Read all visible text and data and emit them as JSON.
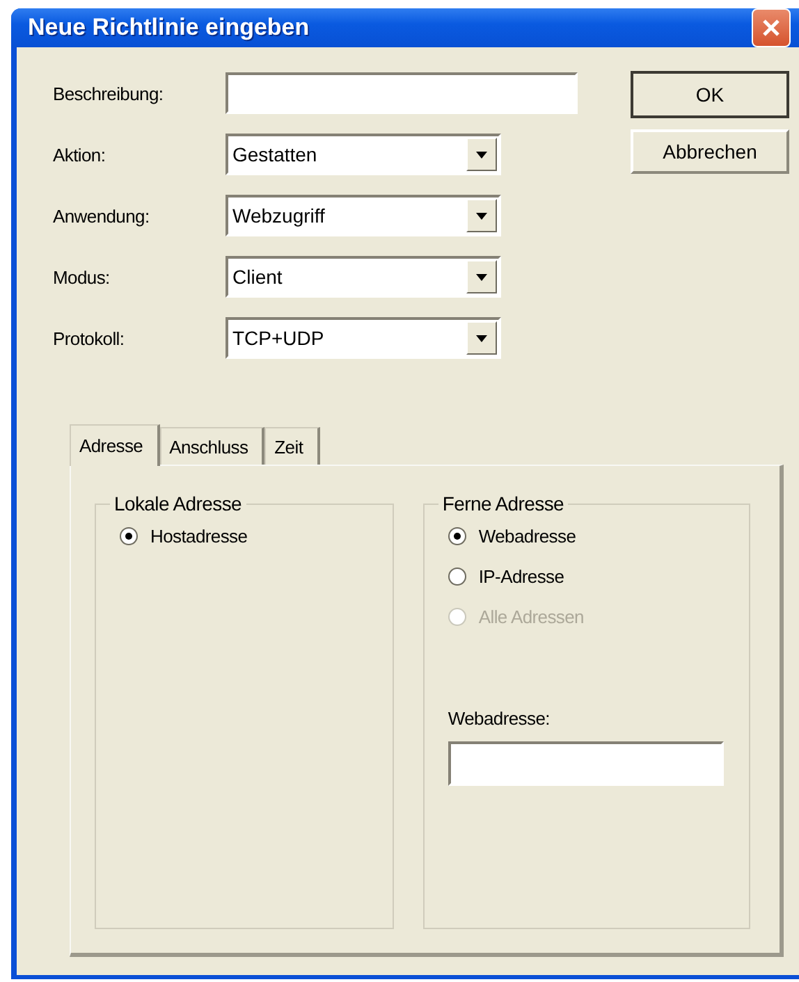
{
  "window": {
    "title": "Neue Richtlinie eingeben"
  },
  "fields": [
    {
      "kind": "text",
      "label": "Beschreibung:"
    },
    {
      "kind": "combo",
      "label": "Aktion:",
      "value": "Gestatten"
    },
    {
      "kind": "combo",
      "label": "Anwendung:",
      "value": "Webzugriff"
    },
    {
      "kind": "combo",
      "label": "Modus:",
      "value": "Client"
    },
    {
      "kind": "combo",
      "label": "Protokoll:",
      "value": "TCP+UDP"
    }
  ],
  "buttons": [
    {
      "label": "OK",
      "default": true
    },
    {
      "label": "Abbrechen",
      "default": false
    }
  ],
  "tabs": [
    {
      "label": "Adresse",
      "selected": true
    },
    {
      "label": "Anschluss",
      "selected": false
    },
    {
      "label": "Zeit",
      "selected": false
    }
  ],
  "groups": [
    {
      "title": "Lokale Adresse",
      "options": [
        {
          "label": "Hostadresse",
          "selected": true,
          "disabled": false
        }
      ]
    },
    {
      "title": "Ferne Adresse",
      "options": [
        {
          "label": "Webadresse",
          "selected": true,
          "disabled": false
        },
        {
          "label": "IP-Adresse",
          "selected": false,
          "disabled": false
        },
        {
          "label": "Alle Adressen",
          "selected": false,
          "disabled": true
        }
      ],
      "field": {
        "label": "Webadresse:"
      }
    }
  ]
}
